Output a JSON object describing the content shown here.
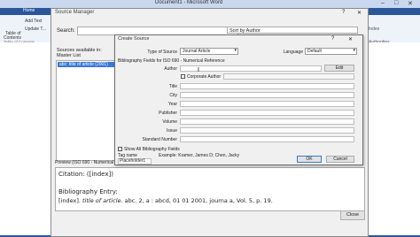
{
  "word": {
    "title": "Document1 - Microsoft Word",
    "home_tab": "Home",
    "add_text": "Add Text",
    "update_table": "Update T...",
    "table_of_contents": "Table of",
    "table_of_contents2": "Contents",
    "table_of_contents_group": "Table of Contents",
    "right_item1": "Index",
    "right_item2": "Authorities"
  },
  "source_manager": {
    "title": "Source Manager",
    "help": "?",
    "close": "✕",
    "search_label": "Search:",
    "sort_value": "Sort by Author",
    "sources_available": "Sources available in:",
    "master_list": "Master List",
    "list_items": [
      "abc: title of article (2001)"
    ],
    "preview_label": "Preview (ISO 690 - Numerical Re...",
    "citation": "Citation: ([index])",
    "bibliography_title": "Bibliography Entry:",
    "bibliography_prefix": "[index]. ",
    "bibliography_italic": "title of article.",
    "bibliography_rest": " abc. 2, a : abcd, 01 01 2001, journa a, Vol. 5, p. 19.",
    "close_button": "Close"
  },
  "create_source": {
    "title": "Create Source",
    "help": "?",
    "close": "✕",
    "type_label": "Type of Source",
    "type_value": "Journal Article",
    "language_label": "Language",
    "language_value": "Default",
    "bib_fields_label": "Bibliography Fields for ISO 690 - Numerical Reference",
    "author_label": "Author",
    "edit_button": "Edit",
    "corporate_author": "Corporate Author",
    "fields": [
      {
        "label": "Title"
      },
      {
        "label": "City"
      },
      {
        "label": "Year"
      },
      {
        "label": "Publisher"
      },
      {
        "label": "Volume"
      },
      {
        "label": "Issue"
      },
      {
        "label": "Standard Number"
      }
    ],
    "show_all": "Show All Bibliography Fields",
    "tag_name_label": "Tag name",
    "example": "Example: Kramer, James D; Chen, Jacky",
    "tag_value": "Placeholder1",
    "ok": "OK",
    "cancel": "Cancel"
  }
}
